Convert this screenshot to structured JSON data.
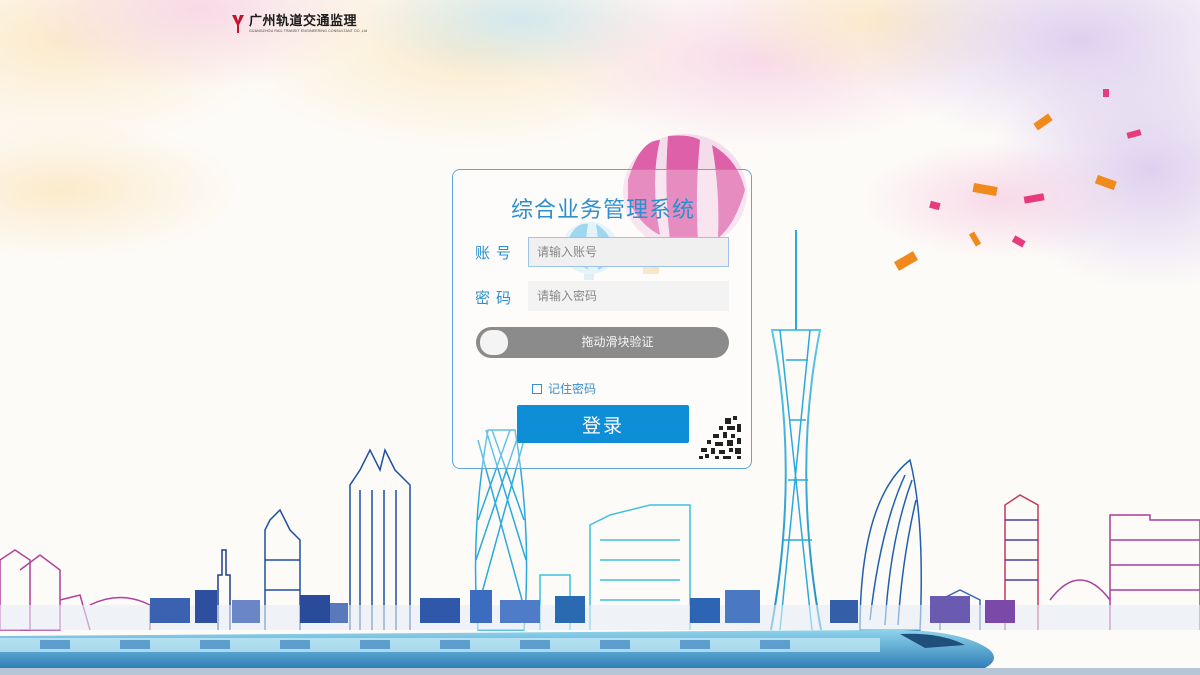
{
  "header": {
    "logo_cn": "广州轨道交通监理",
    "logo_en": "GUANGZHOU RAIL TRANSIT ENGINEERING CONSULTANT CO.,Ltd",
    "logo_icon": "metro-logo-icon"
  },
  "login": {
    "title": "综合业务管理系统",
    "account_label": "账号",
    "account_placeholder": "请输入账号",
    "account_value": "",
    "password_label": "密码",
    "password_placeholder": "请输入密码",
    "password_value": "",
    "slider_text": "拖动滑块验证",
    "slider_progress": 0,
    "remember_label": "记住密码",
    "remember_checked": false,
    "submit_label": "登录",
    "qr_icon": "qr-code-icon"
  },
  "colors": {
    "accent": "#2d8fce",
    "button": "#0e8ed6",
    "slider_track": "#8b8b8b",
    "card_border": "#5fa8d6"
  }
}
